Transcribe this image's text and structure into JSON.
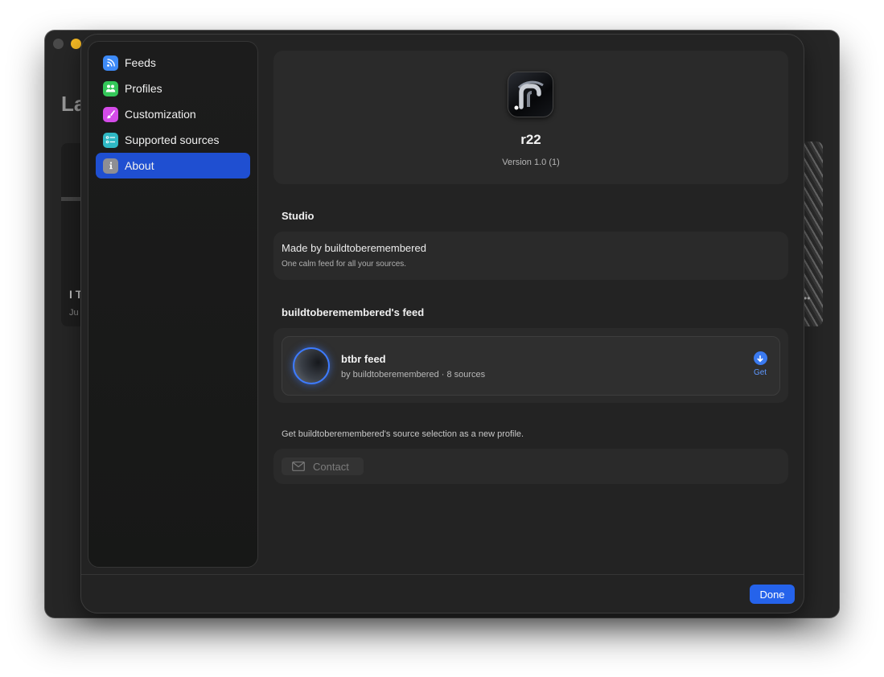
{
  "background_window": {
    "heading": "La",
    "card_title": "I T",
    "card_date": "Ju"
  },
  "sidebar": {
    "items": [
      {
        "label": "Feeds",
        "icon": "rss-icon",
        "color": "#3d8af7",
        "active": false
      },
      {
        "label": "Profiles",
        "icon": "people-icon",
        "color": "#34c759",
        "active": false
      },
      {
        "label": "Customization",
        "icon": "brush-icon",
        "color": "#d44be8",
        "active": false
      },
      {
        "label": "Supported sources",
        "icon": "list-icon",
        "color": "#2fb8c4",
        "active": false
      },
      {
        "label": "About",
        "icon": "info-icon",
        "color": "#8e8e93",
        "active": true
      }
    ]
  },
  "about": {
    "app_name": "r22",
    "version": "Version 1.0 (1)"
  },
  "studio": {
    "section_title": "Studio",
    "made_by": "Made by buildtoberemembered",
    "tagline": "One calm feed for all your sources."
  },
  "feed_section": {
    "title": "buildtoberemembered's feed",
    "feed_name": "btbr feed",
    "feed_subtitle": "by buildtoberemembered · 8 sources",
    "get_label": "Get",
    "hint": "Get buildtoberemembered's source selection as a new profile."
  },
  "contact": {
    "label": "Contact"
  },
  "footer": {
    "done_label": "Done"
  },
  "colors": {
    "accent": "#2563eb",
    "active_nav": "#1f4fd1"
  }
}
